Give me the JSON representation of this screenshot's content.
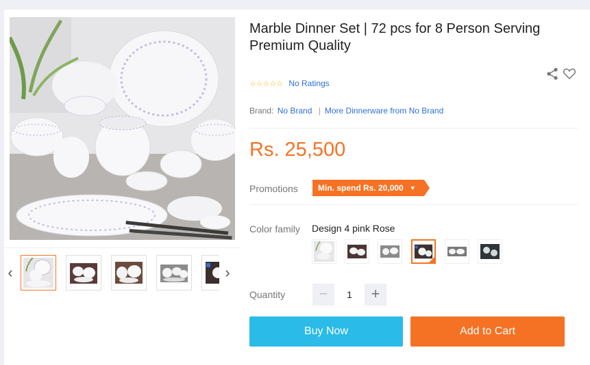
{
  "product": {
    "title": "Marble Dinner Set | 72 pcs for 8 Person Serving Premium Quality",
    "rating_stars": "☆☆☆☆☆",
    "rating_text": "No Ratings",
    "brand_label": "Brand:",
    "brand_name": "No Brand",
    "brand_more": "More Dinnerware from No Brand",
    "price": "Rs. 25,500"
  },
  "promotions": {
    "label": "Promotions",
    "tag": "Min. spend Rs. 20,000"
  },
  "color_family": {
    "label": "Color family",
    "selected_name": "Design 4 pink Rose",
    "selected_index": 3,
    "swatch_count": 6
  },
  "quantity": {
    "label": "Quantity",
    "value": "1",
    "minus": "−",
    "plus": "+"
  },
  "gallery": {
    "active_thumb": 0,
    "thumb_count": 5,
    "prev_arrow": "‹",
    "next_arrow": "›"
  },
  "actions": {
    "buy_now": "Buy Now",
    "add_to_cart": "Add to Cart"
  },
  "colors": {
    "accent": "#f57224",
    "buy": "#2abbe8",
    "link": "#2e6fd9",
    "price": "#f57224"
  },
  "icons": {
    "share": "share-icon",
    "wishlist": "heart-icon",
    "prev": "chevron-left-icon",
    "next": "chevron-right-icon"
  }
}
